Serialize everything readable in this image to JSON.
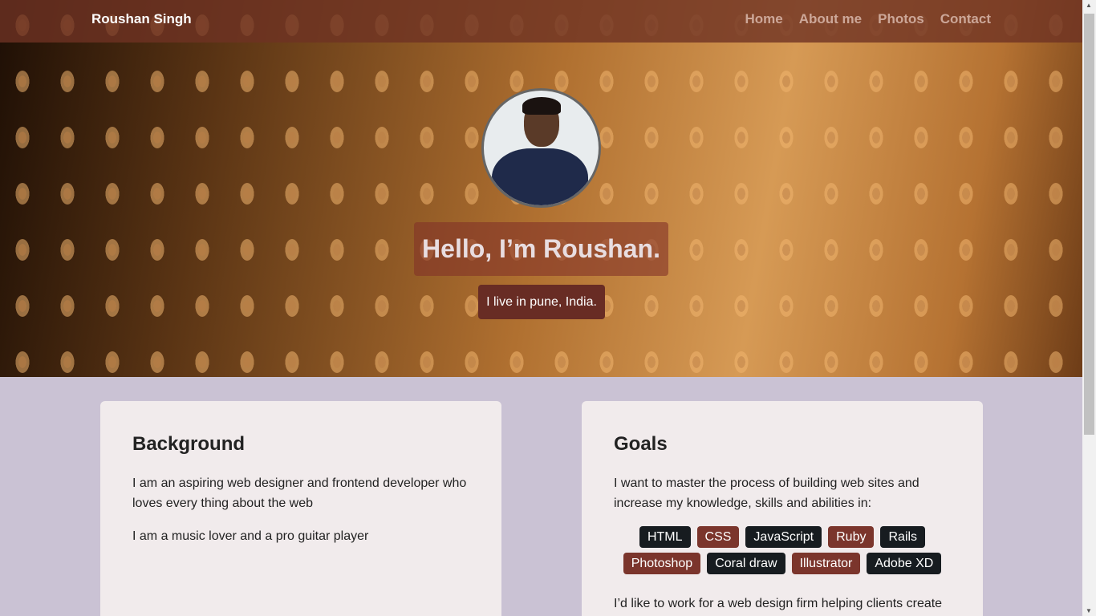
{
  "nav": {
    "brand": "Roushan Singh",
    "links": [
      "Home",
      "About me",
      "Photos",
      "Contact"
    ]
  },
  "hero": {
    "heading": "Hello, I’m Roushan.",
    "subheading": "I live in pune, India."
  },
  "background": {
    "title": "Background",
    "paragraphs": [
      "I am an aspiring web designer and frontend developer who loves every thing about the web",
      "I am a music lover and a pro guitar player"
    ]
  },
  "goals": {
    "title": "Goals",
    "intro": "I want to master the process of building web sites and increase my knowledge, skills and abilities in:",
    "tags": [
      {
        "label": "HTML",
        "color": "#171c20"
      },
      {
        "label": "CSS",
        "color": "#7b352c"
      },
      {
        "label": "JavaScript",
        "color": "#171c20"
      },
      {
        "label": "Ruby",
        "color": "#7b352c"
      },
      {
        "label": "Rails",
        "color": "#171c20"
      },
      {
        "label": "Photoshop",
        "color": "#7b352c"
      },
      {
        "label": "Coral draw",
        "color": "#171c20"
      },
      {
        "label": "Illustrator",
        "color": "#7b352c"
      },
      {
        "label": "Adobe XD",
        "color": "#171c20"
      }
    ],
    "outro": "I’d like to work for a web design firm helping clients create"
  }
}
